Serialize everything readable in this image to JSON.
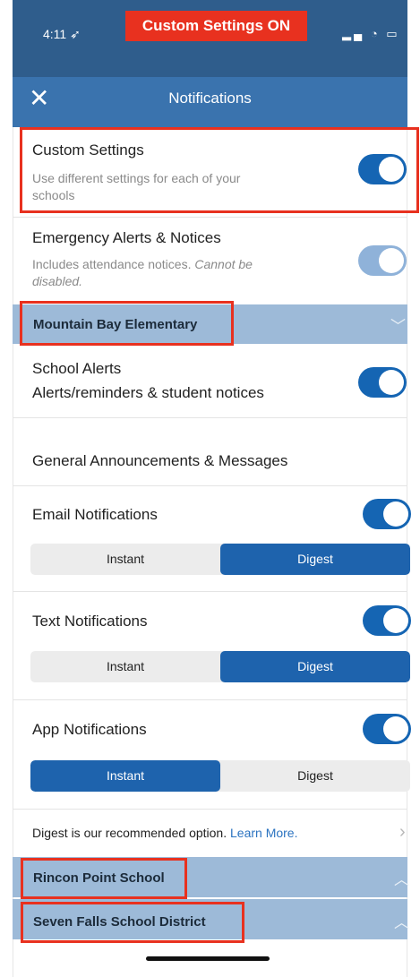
{
  "status_bar": {
    "time": "4:11",
    "banner": "Custom Settings ON"
  },
  "header": {
    "title": "Notifications",
    "close_icon": "close-icon"
  },
  "custom_settings": {
    "label": "Custom Settings",
    "description": "Use different settings for each of your schools",
    "enabled": true
  },
  "emergency": {
    "label": "Emergency Alerts & Notices",
    "description_plain": "Includes attendance notices.",
    "description_italic": "Cannot be disabled.",
    "enabled": true
  },
  "schools": [
    {
      "name": "Mountain Bay Elementary",
      "expanded": true
    },
    {
      "name": "Rincon Point School",
      "expanded": false
    },
    {
      "name": "Seven Falls School District",
      "expanded": false
    }
  ],
  "school_alerts": {
    "label": "School Alerts",
    "description": "Alerts/reminders & student notices",
    "enabled": true
  },
  "general_heading": "General Announcements & Messages",
  "email": {
    "label": "Email Notifications",
    "enabled": true,
    "options": [
      "Instant",
      "Digest"
    ],
    "selected": "Digest"
  },
  "text": {
    "label": "Text Notifications",
    "enabled": true,
    "options": [
      "Instant",
      "Digest"
    ],
    "selected": "Digest"
  },
  "app": {
    "label": "App Notifications",
    "enabled": true,
    "options": [
      "Instant",
      "Digest"
    ],
    "selected": "Instant"
  },
  "digest_note": {
    "text": "Digest is our recommended option.",
    "link": "Learn More."
  },
  "colors": {
    "header": "#3a73ae",
    "accent": "#1565b3",
    "highlight": "#e8311f",
    "section_bar": "#9dbad8"
  }
}
